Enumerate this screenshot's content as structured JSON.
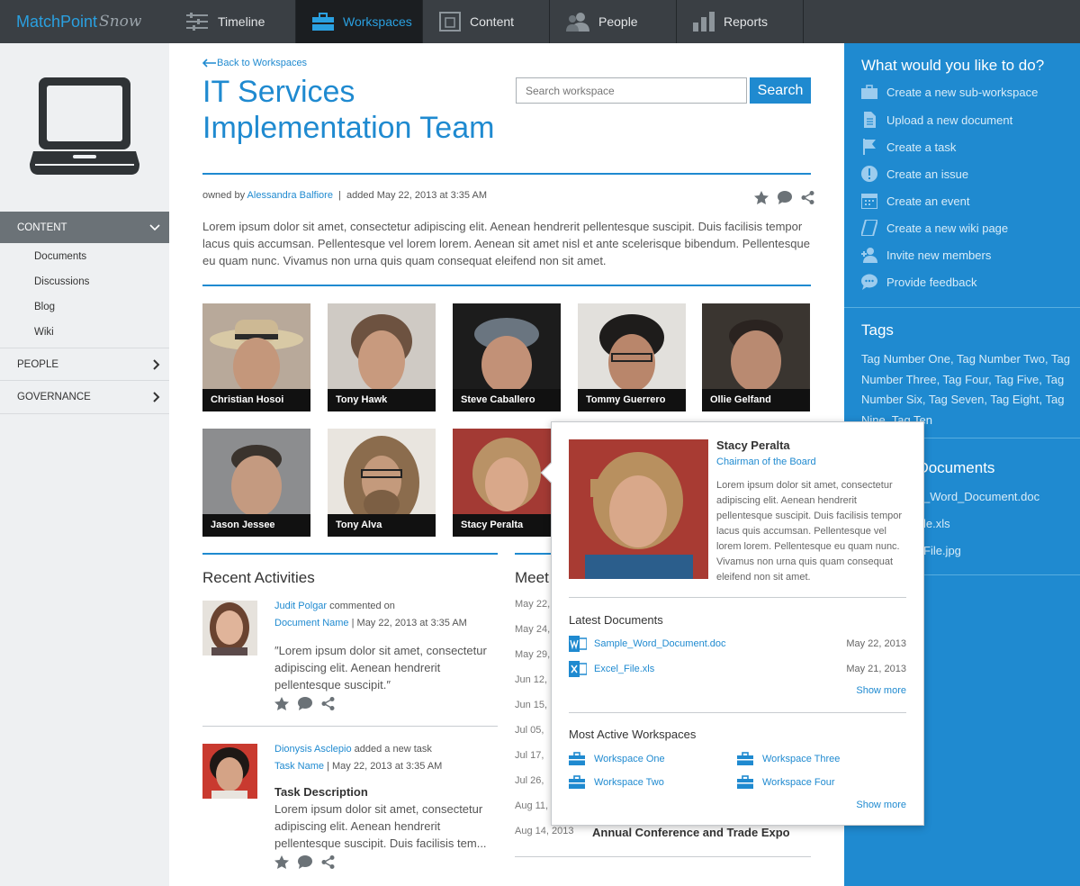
{
  "app": {
    "brand": "MatchPoint",
    "brand_suffix": "Snow"
  },
  "nav": [
    {
      "label": "Timeline",
      "icon": "timeline-icon"
    },
    {
      "label": "Workspaces",
      "icon": "briefcase-icon",
      "active": true
    },
    {
      "label": "Content",
      "icon": "content-icon"
    },
    {
      "label": "People",
      "icon": "people-icon"
    },
    {
      "label": "Reports",
      "icon": "reports-icon"
    }
  ],
  "sidebar": {
    "content_label": "CONTENT",
    "content_items": [
      "Documents",
      "Discussions",
      "Blog",
      "Wiki"
    ],
    "people_label": "PEOPLE",
    "governance_label": "GOVERNANCE"
  },
  "workspace": {
    "back_label": "Back to Workspaces",
    "title": "IT Services Implementation Team",
    "search_placeholder": "Search workspace",
    "search_button": "Search",
    "owned_by_prefix": "owned by",
    "owner": "Alessandra Balfiore",
    "added": "added May 22, 2013 at 3:35 AM",
    "description": "Lorem ipsum dolor sit amet, consectetur adipiscing elit. Aenean hendrerit pellentesque suscipit. Duis facilisis tempor lacus quis accumsan. Pellentesque vel lorem lorem. Aenean sit amet nisl et ante scelerisque bibendum. Pellentesque eu quam nunc. Vivamus non urna quis quam consequat eleifend non sit amet."
  },
  "members": [
    {
      "name": "Christian Hosoi"
    },
    {
      "name": "Tony Hawk"
    },
    {
      "name": "Steve Caballero"
    },
    {
      "name": "Tommy Guerrero"
    },
    {
      "name": "Ollie Gelfand"
    },
    {
      "name": "Jason Jessee"
    },
    {
      "name": "Tony Alva"
    },
    {
      "name": "Stacy Peralta"
    }
  ],
  "activities": {
    "title": "Recent Activities",
    "items": [
      {
        "user": "Judit Polgar",
        "action": "commented on",
        "target": "Document Name",
        "time": "May 22, 2013 at 3:35 AM",
        "quote": "Lorem ipsum dolor sit amet, consectetur adipiscing elit. Aenean hendrerit pellentesque suscipit."
      },
      {
        "user": "Dionysis Asclepio",
        "action": "added a new task",
        "target": "Task Name",
        "time": "May 22, 2013 at 3:35 AM",
        "task_title": "Task Description",
        "quote": "Lorem ipsum dolor sit amet, consectetur adipiscing elit. Aenean hendrerit pellentesque suscipit. Duis facilisis tem..."
      }
    ]
  },
  "meetings": {
    "title": "Meet",
    "dates": [
      "May 22,",
      "May 24,",
      "May 29,",
      "Jun 12,",
      "Jun 15,",
      "Jul 05,",
      "Jul 17,",
      "Jul 26,",
      "Aug 11,",
      "Aug 14, 2013"
    ],
    "last_title": "Annual Conference and Trade Expo"
  },
  "actions_panel": {
    "title": "What would you like to do?",
    "items": [
      {
        "label": "Create a new sub-workspace",
        "icon": "briefcase-icon"
      },
      {
        "label": "Upload a new document",
        "icon": "document-icon"
      },
      {
        "label": "Create a task",
        "icon": "flag-icon"
      },
      {
        "label": "Create an issue",
        "icon": "alert-icon"
      },
      {
        "label": "Create an event",
        "icon": "calendar-icon"
      },
      {
        "label": "Create a new wiki page",
        "icon": "wiki-icon"
      },
      {
        "label": "Invite new members",
        "icon": "add-user-icon"
      },
      {
        "label": "Provide feedback",
        "icon": "feedback-icon"
      }
    ],
    "tags_title": "Tags",
    "tags": "Tag Number One, Tag Number Two, Tag Number Three, Tag Four, Tag Five, Tag Number Six, Tag Seven, Tag Eight, Tag Nine, Tag Ten",
    "docs_title": "t Documents",
    "docs": [
      "_Word_Document.doc",
      "le.xls",
      "File.jpg"
    ]
  },
  "popup": {
    "name": "Stacy Peralta",
    "role": "Chairman of the Board",
    "bio": "Lorem ipsum dolor sit amet, consectetur adipiscing elit. Aenean hendrerit pellentesque suscipit. Duis facilisis tempor lacus quis accumsan. Pellentesque vel lorem lorem. Pellentesque eu quam nunc. Vivamus non urna quis quam consequat eleifend non sit amet.",
    "latest_docs_title": "Latest Documents",
    "docs": [
      {
        "name": "Sample_Word_Document.doc",
        "date": "May 22, 2013",
        "icon": "word-icon"
      },
      {
        "name": "Excel_File.xls",
        "date": "May 21, 2013",
        "icon": "excel-icon"
      }
    ],
    "show_more": "Show more",
    "workspaces_title": "Most Active Workspaces",
    "workspaces": [
      "Workspace One",
      "Workspace Three",
      "Workspace Two",
      "Workspace Four"
    ]
  },
  "colors": {
    "accent": "#1f8ad0",
    "topbar": "#3a3f44",
    "sidebar": "#eef0f2"
  }
}
